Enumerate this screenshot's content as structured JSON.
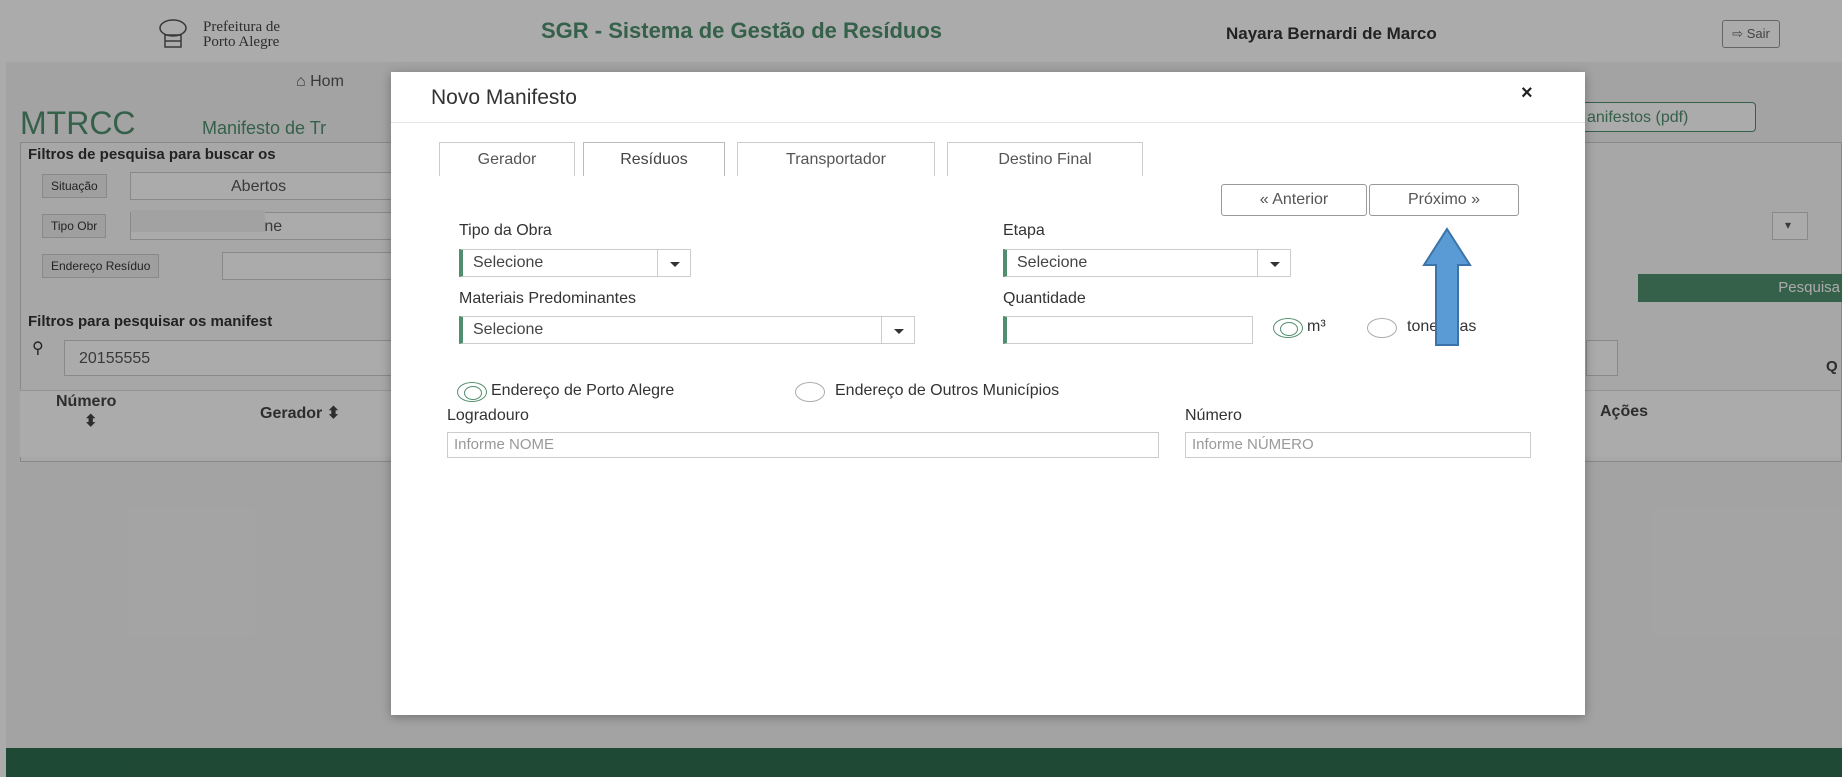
{
  "header": {
    "logo_line1": "Prefeitura de",
    "logo_line2": "Porto Alegre",
    "app_title": "SGR - Sistema de Gestão de Resíduos",
    "user_name": "Nayara Bernardi de Marco",
    "exit_label": "Sair",
    "exit_icon": "sign-out-icon"
  },
  "nav": {
    "home_label": "Hom",
    "home_icon": "home-icon"
  },
  "page": {
    "title": "MTRCC",
    "subtitle": "Manifesto de Tr",
    "pdf_button": "anifestos (pdf)"
  },
  "filters": {
    "heading": "Filtros de pesquisa para buscar os",
    "situacao_label": "Situação",
    "situacao_value": "Abertos",
    "tipo_obra_label": "Tipo Obr",
    "tipo_obra_value": "ecione",
    "endereco_label": "Endereço Resíduo",
    "search_button": "Pesquisa",
    "manifest_heading": "Filtros para pesquisar os manifest",
    "manifest_search_value": "20155555",
    "right_cut_text": "Q"
  },
  "table": {
    "col_numero": "Número",
    "col_gerador": "Gerador",
    "col_acoes": "Ações"
  },
  "modal": {
    "title": "Novo Manifesto",
    "close": "×",
    "tabs": [
      "Gerador",
      "Resíduos",
      "Transportador",
      "Destino Final"
    ],
    "prev_button": "« Anterior",
    "next_button": "Próximo »",
    "tipo_obra_label": "Tipo da Obra",
    "tipo_obra_value": "Selecione",
    "etapa_label": "Etapa",
    "etapa_value": "Selecione",
    "materiais_label": "Materiais Predominantes",
    "materiais_value": "Selecione",
    "quantidade_label": "Quantidade",
    "quantidade_value": "",
    "unit_m3": "m³",
    "unit_ton": "toneladas",
    "addr_poa": "Endereço de Porto Alegre",
    "addr_outros": "Endereço de Outros Municípios",
    "logradouro_label": "Logradouro",
    "logradouro_placeholder": "Informe NOME",
    "numero_label": "Número",
    "numero_placeholder": "Informe NÚMERO"
  },
  "colors": {
    "brand_green": "#4f8f6f",
    "footer_green": "#2e6d4f",
    "arrow_blue": "#5b9bd5"
  }
}
